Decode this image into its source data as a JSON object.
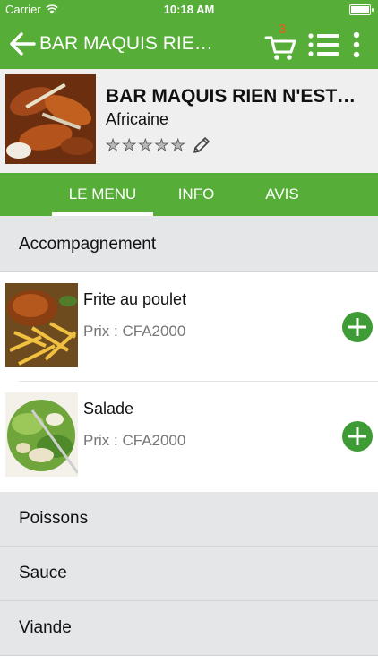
{
  "status_bar": {
    "carrier": "Carrier",
    "time": "10:18 AM"
  },
  "nav": {
    "title": "BAR MAQUIS RIE…",
    "cart_count": "3"
  },
  "restaurant": {
    "name": "BAR MAQUIS RIEN N'EST…",
    "cuisine": "Africaine",
    "rating": 0,
    "max_rating": 5
  },
  "tabs": [
    {
      "label": "LE MENU",
      "active": true
    },
    {
      "label": "INFO",
      "active": false
    },
    {
      "label": "AVIS",
      "active": false
    }
  ],
  "categories": {
    "first": "Accompagnement",
    "rest": [
      "Poissons",
      "Sauce",
      "Viande"
    ]
  },
  "items": [
    {
      "name": "Frite  au poulet",
      "price": "Prix : CFA2000"
    },
    {
      "name": "Salade",
      "price": "Prix : CFA2000"
    }
  ],
  "colors": {
    "primary": "#56ae38",
    "cart_badge": "#e85d1a",
    "category_bg": "#e4e6e8"
  }
}
